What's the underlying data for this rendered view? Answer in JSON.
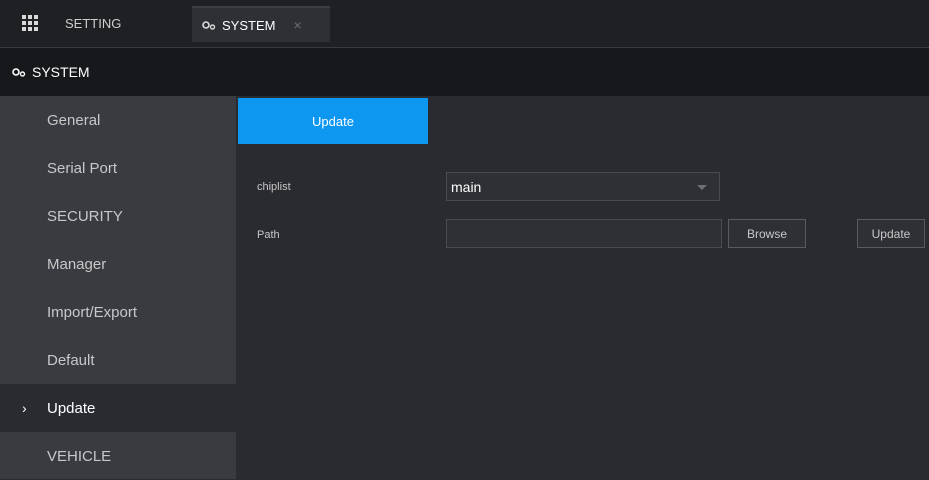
{
  "tabs": {
    "setting_label": "SETTING",
    "system_label": "SYSTEM",
    "close_symbol": "×"
  },
  "header": {
    "title": "SYSTEM"
  },
  "sidebar": {
    "items": [
      {
        "label": "General"
      },
      {
        "label": "Serial Port"
      },
      {
        "label": "SECURITY"
      },
      {
        "label": "Manager"
      },
      {
        "label": "Import/Export"
      },
      {
        "label": "Default"
      },
      {
        "label": "Update",
        "active": true,
        "chevron": "›"
      },
      {
        "label": "VEHICLE"
      }
    ]
  },
  "main": {
    "subtab_label": "Update",
    "chiplist_label": "chiplist",
    "chiplist_value": "main",
    "path_label": "Path",
    "path_value": "",
    "browse_label": "Browse",
    "update_label": "Update"
  },
  "colors": {
    "accent": "#0e97f1",
    "background": "#2a2b30",
    "sidebar": "#3a3b40",
    "header": "#17181b"
  },
  "icons": {
    "setting": "grid-icon",
    "system": "gear-icon",
    "chevron": "chevron-right-icon",
    "caret": "caret-down-icon"
  }
}
